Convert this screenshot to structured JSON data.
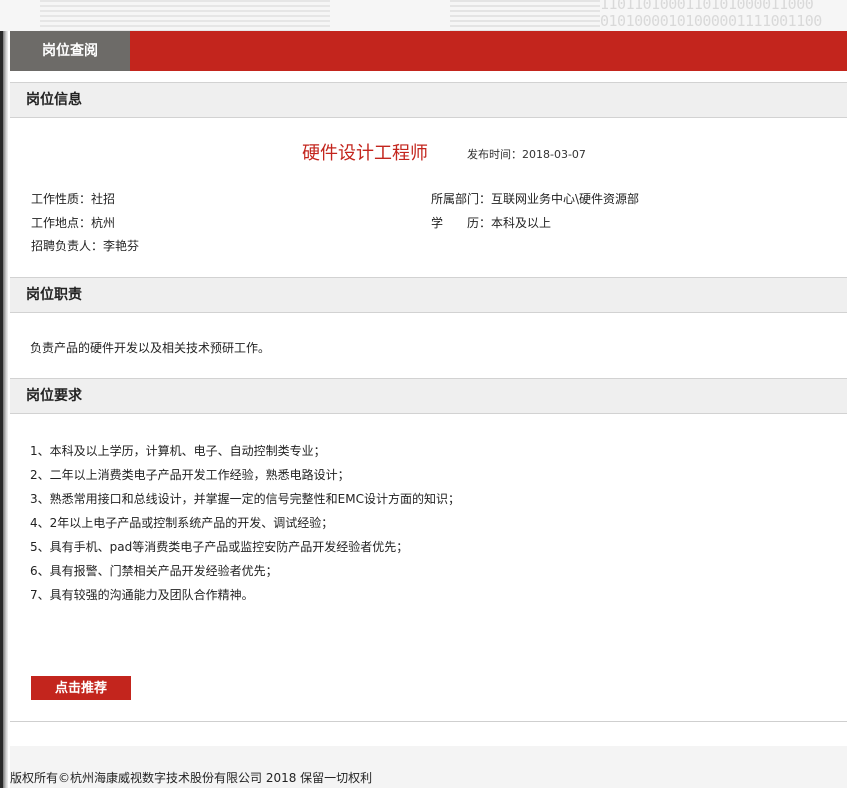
{
  "header": {
    "tab_label": "岗位查阅",
    "decor_digits": "1101101000110101000011000\n01010000101000001111001100"
  },
  "sections": {
    "info_title": "岗位信息",
    "duty_title": "岗位职责",
    "req_title": "岗位要求"
  },
  "job": {
    "title": "硬件设计工程师",
    "publish_label": "发布时间：",
    "publish_date": "2018-03-07",
    "fields": {
      "nature": "工作性质：社招",
      "department": "所属部门：互联网业务中心\\硬件资源部",
      "location": "工作地点：杭州",
      "education": "学　　历：本科及以上",
      "recruiter": "招聘负责人：李艳芬"
    },
    "duty": "负责产品的硬件开发以及相关技术预研工作。",
    "requirements": [
      "1、本科及以上学历，计算机、电子、自动控制类专业；",
      "2、二年以上消费类电子产品开发工作经验，熟悉电路设计；",
      "3、熟悉常用接口和总线设计，并掌握一定的信号完整性和EMC设计方面的知识；",
      "4、2年以上电子产品或控制系统产品的开发、调试经验；",
      "5、具有手机、pad等消费类电子产品或监控安防产品开发经验者优先；",
      "6、具有报警、门禁相关产品开发经验者优先；",
      "7、具有较强的沟通能力及团队合作精神。"
    ]
  },
  "actions": {
    "recommend_label": "点击推荐"
  },
  "footer": {
    "copyright": "版权所有©杭州海康威视数字技术股份有限公司 2018 保留一切权利"
  },
  "colors": {
    "accent": "#c3251d",
    "tab_gray": "#6d6b68",
    "section_bg": "#efefef"
  }
}
